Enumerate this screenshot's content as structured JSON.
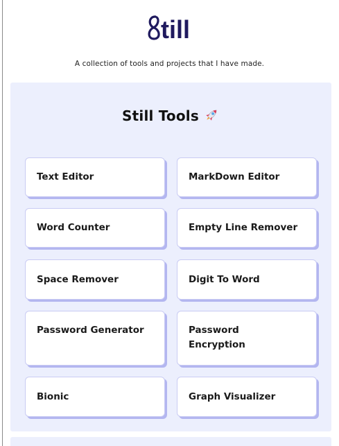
{
  "header": {
    "logo_text": "Still",
    "logo_color": "#1f1a5e",
    "tagline": "A collection of tools and projects that I have made."
  },
  "tools_section": {
    "title": "Still Tools",
    "title_emoji": "rocket-icon",
    "panel_color": "#eceffd",
    "card_shadow_color": "#b3b6f0",
    "cards": [
      {
        "label": "Text Editor"
      },
      {
        "label": "MarkDown Editor"
      },
      {
        "label": "Word Counter"
      },
      {
        "label": "Empty Line Remover"
      },
      {
        "label": "Space Remover"
      },
      {
        "label": "Digit To Word"
      },
      {
        "label": "Password Generator"
      },
      {
        "label": "Password Encryption"
      },
      {
        "label": "Bionic"
      },
      {
        "label": "Graph Visualizer"
      }
    ]
  }
}
